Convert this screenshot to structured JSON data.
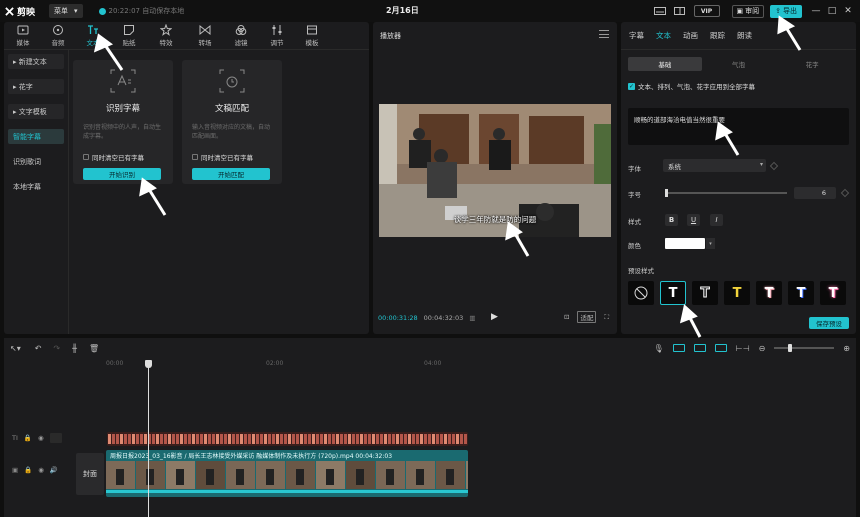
{
  "app": {
    "name": "剪映",
    "menu_label": "菜单",
    "autosave_text": "20:22:07 自动保存本地",
    "project_title": "2月16日"
  },
  "titlebar": {
    "vip_label": "VIP",
    "review_label": "审阅",
    "export_label": "导出"
  },
  "toolbar": {
    "tools": [
      {
        "label": "媒体",
        "icon": "media-icon"
      },
      {
        "label": "音频",
        "icon": "audio-icon"
      },
      {
        "label": "文本",
        "icon": "text-icon",
        "active": true
      },
      {
        "label": "贴纸",
        "icon": "sticker-icon"
      },
      {
        "label": "特效",
        "icon": "effects-icon"
      },
      {
        "label": "转场",
        "icon": "transition-icon"
      },
      {
        "label": "滤镜",
        "icon": "filter-icon"
      },
      {
        "label": "调节",
        "icon": "adjust-icon"
      },
      {
        "label": "模板",
        "icon": "template-icon"
      }
    ]
  },
  "leftnav": {
    "items": [
      "▸ 新建文本",
      "▸ 花字",
      "▸ 文字模板",
      "智能字幕",
      "识别歌词",
      "本地字幕"
    ]
  },
  "cards": [
    {
      "title": "识别字幕",
      "desc": "识别音视频中的人声，自动生成字幕。",
      "check": "同时清空已有字幕",
      "button": "开始识别"
    },
    {
      "title": "文稿匹配",
      "desc": "输入音视频对应的文稿，自动匹配画面。",
      "check": "同时清空已有字幕",
      "button": "开始匹配"
    }
  ],
  "player": {
    "title": "播放器",
    "subtitle": "谈学三年防就是防的问题",
    "current_time": "00:00:31:28",
    "total_time": "00:04:32:03",
    "ratio_label": "适配"
  },
  "right": {
    "tabs": [
      "字幕",
      "文本",
      "动画",
      "跟踪",
      "朗读"
    ],
    "segments": [
      "基础",
      "气泡",
      "花字"
    ],
    "apply_all": "文本、排列、气泡、花字应用到全部字幕",
    "text_value": "顺畅的道部海洽电值当然很重要",
    "font_label": "字体",
    "font_value": "系统",
    "size_label": "字号",
    "size_value": "6",
    "size_fraction": 0.0,
    "style_label": "样式",
    "style_buttons": [
      "B",
      "U",
      "I"
    ],
    "color_label": "颜色",
    "color_value": "#ffffff",
    "preset_label": "预设样式",
    "presets": [
      "none",
      "T",
      "T",
      "T",
      "T",
      "T",
      "T"
    ],
    "save_label": "保存预设"
  },
  "timeline": {
    "ticks": [
      "00:00",
      "02:00",
      "04:00"
    ],
    "cover_label": "封面",
    "video_label": "周报日报2023_03_16影音 / 局长王志林接受外媒采访  融媒体制作及未执行方 (720p).mp4  00:04:32:03"
  }
}
